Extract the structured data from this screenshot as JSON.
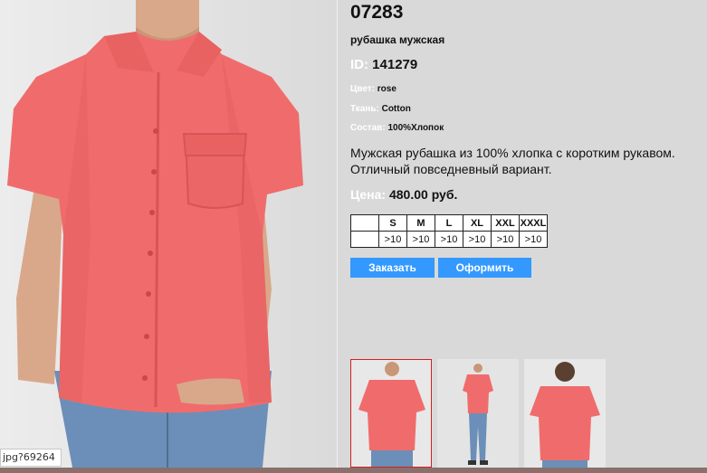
{
  "product": {
    "article": "07283",
    "subtitle": "рубашка мужская",
    "id_label": "ID:",
    "id_value": "141279",
    "attributes": [
      {
        "label": "Цвет:",
        "value": "rose"
      },
      {
        "label": "Ткань:",
        "value": "Cotton"
      },
      {
        "label": "Состав:",
        "value": "100%Хлопок"
      }
    ],
    "description": "Мужская рубашка из 100% хлопка с коротким рукавом. Отличный повседневный вариант.",
    "price_label": "Цена:",
    "price_value": "480.00 руб."
  },
  "sizes": {
    "headers": [
      "S",
      "M",
      "L",
      "XL",
      "XXL",
      "XXXL"
    ],
    "stock": [
      ">10",
      ">10",
      ">10",
      ">10",
      ">10",
      ">10"
    ]
  },
  "buttons": {
    "order": "Заказать",
    "checkout": "Оформить"
  },
  "status_url": "jpg?69264",
  "colors": {
    "page_bg": "#d9d9d9",
    "button": "#3399ff",
    "shirt": "#f06c6c",
    "active_thumb_border": "#cc2222"
  }
}
